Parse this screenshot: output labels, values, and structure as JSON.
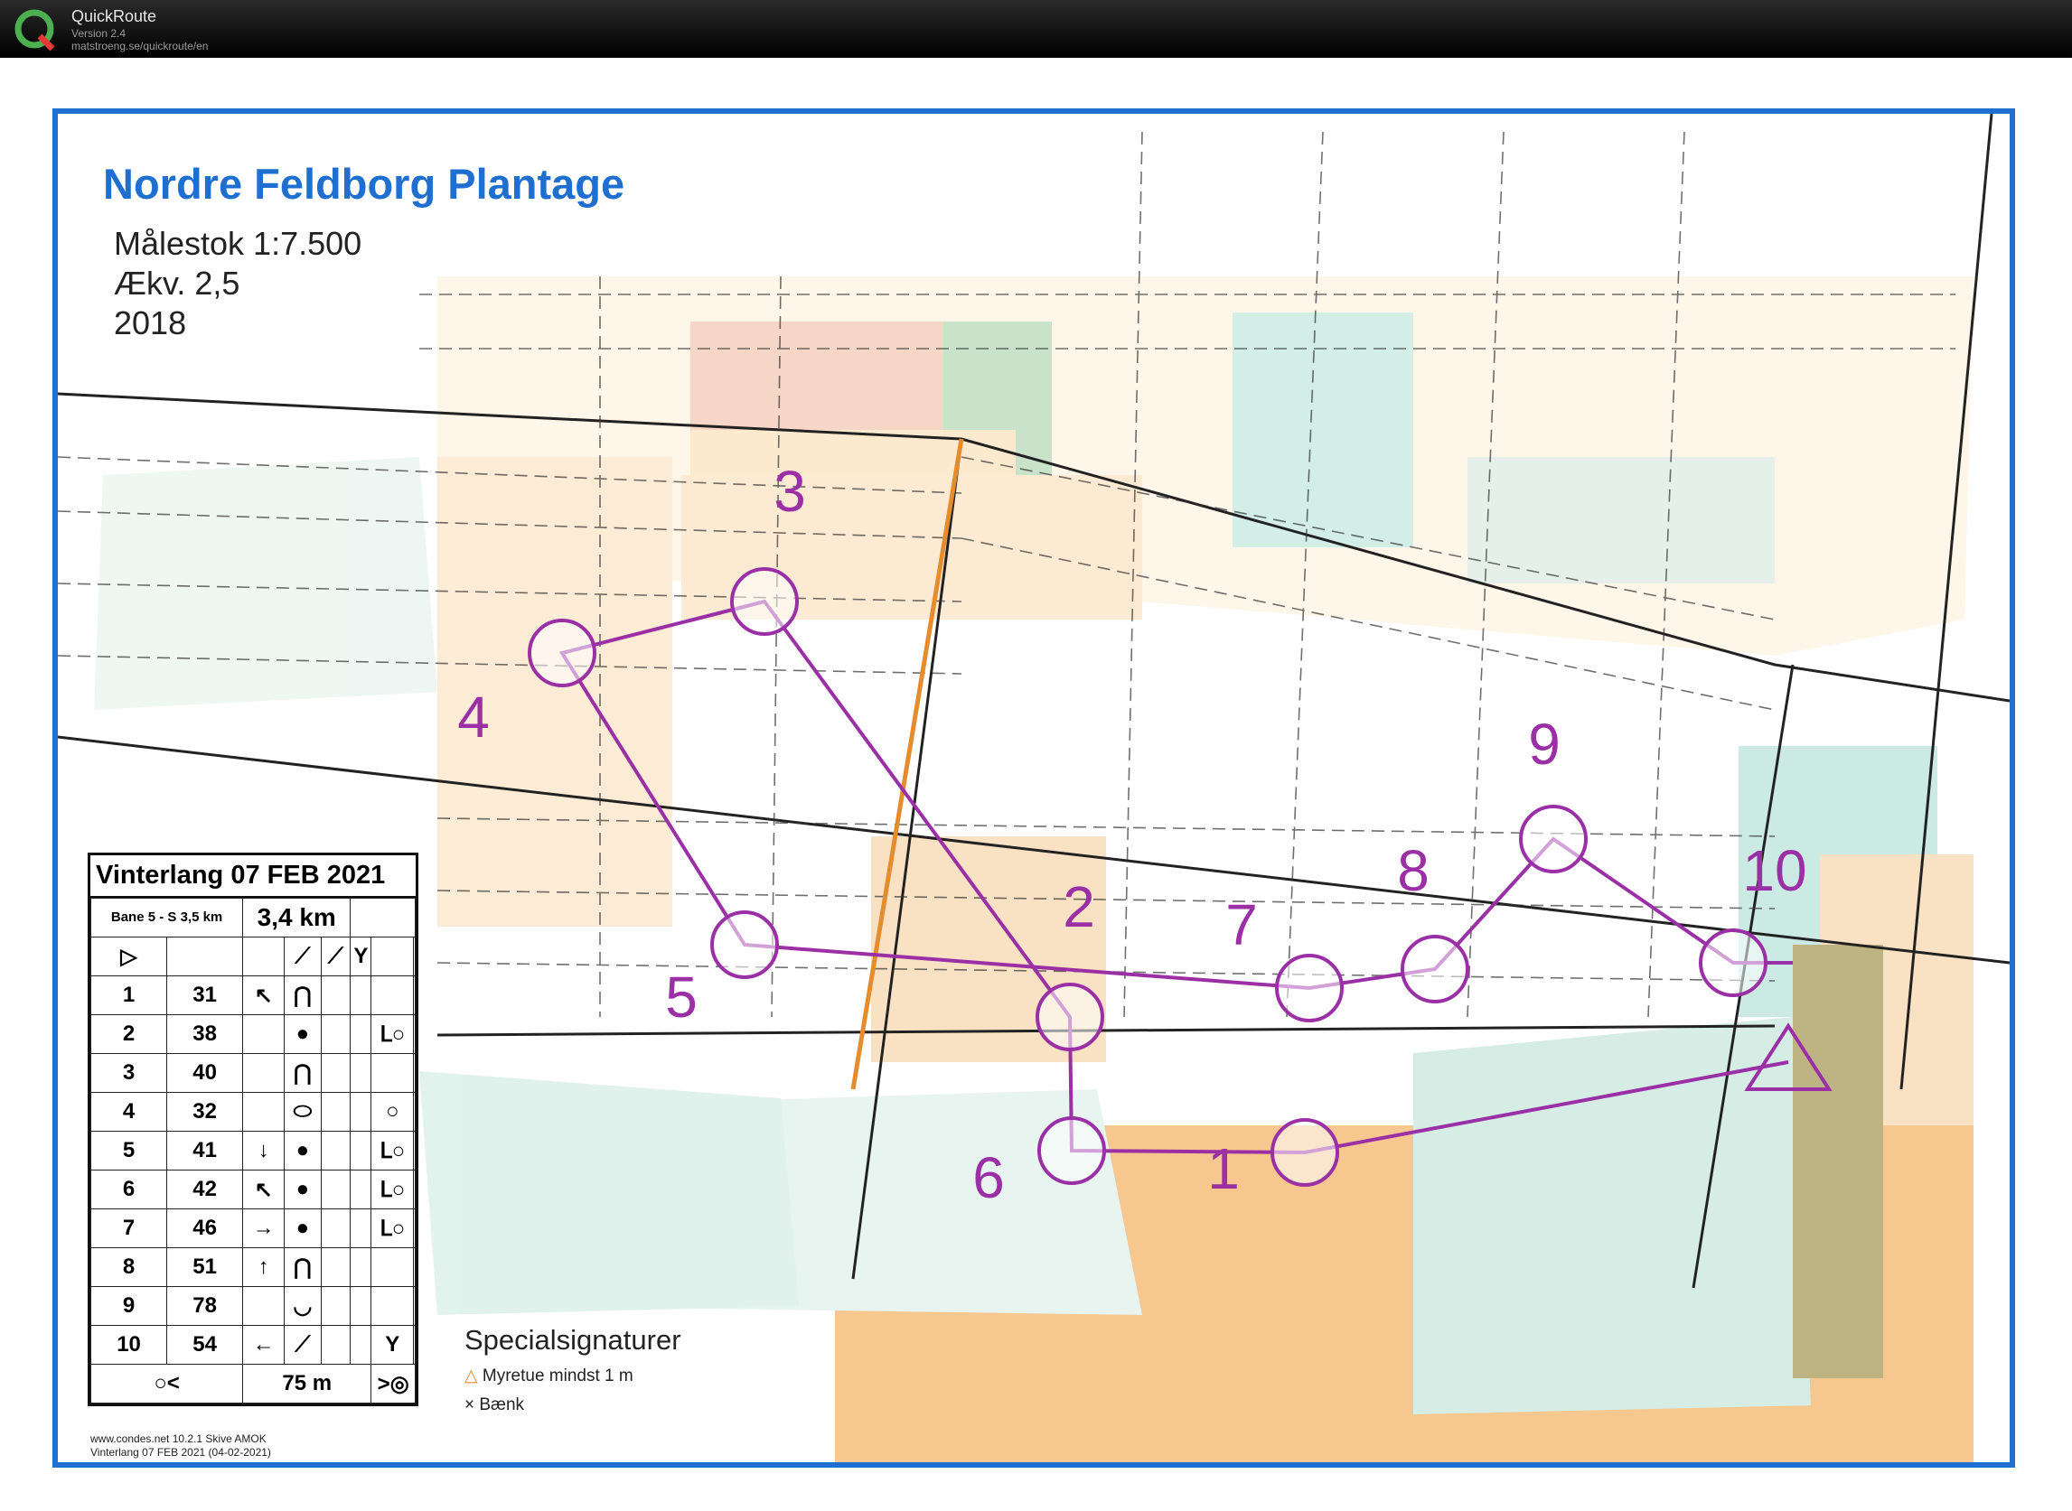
{
  "app": {
    "title": "QuickRoute",
    "version": "Version 2.4",
    "url": "matstroeng.se/quickroute/en"
  },
  "map": {
    "title": "Nordre Feldborg Plantage",
    "scale": "Målestok 1:7.500",
    "equidistance": "Ækv. 2,5",
    "year": "2018",
    "colors": {
      "course": "#9b2fa6",
      "frame": "#1f6fd0",
      "forest_open": "#f5d9a8",
      "green": "#b9e3da"
    }
  },
  "course": {
    "controls": [
      {
        "label": "1"
      },
      {
        "label": "2"
      },
      {
        "label": "3"
      },
      {
        "label": "4"
      },
      {
        "label": "5"
      },
      {
        "label": "6"
      },
      {
        "label": "7"
      },
      {
        "label": "8"
      },
      {
        "label": "9"
      },
      {
        "label": "10"
      }
    ]
  },
  "legend": {
    "title": "Vinterlang 07 FEB 2021",
    "course_name": "Bane 5 - S 3,5 km",
    "length": "3,4 km",
    "rows": [
      {
        "num": "1",
        "code": "31",
        "dir": "↖",
        "feat": "⋂",
        "extra": ""
      },
      {
        "num": "2",
        "code": "38",
        "dir": "",
        "feat": "●",
        "extra": "ᒪ○"
      },
      {
        "num": "3",
        "code": "40",
        "dir": "",
        "feat": "⋂",
        "extra": ""
      },
      {
        "num": "4",
        "code": "32",
        "dir": "",
        "feat": "⬭",
        "extra": "○"
      },
      {
        "num": "5",
        "code": "41",
        "dir": "↓",
        "feat": "●",
        "extra": "ᒪ○"
      },
      {
        "num": "6",
        "code": "42",
        "dir": "↖",
        "feat": "●",
        "extra": "ᒪ○"
      },
      {
        "num": "7",
        "code": "46",
        "dir": "→",
        "feat": "●",
        "extra": "ᒪ○"
      },
      {
        "num": "8",
        "code": "51",
        "dir": "↑",
        "feat": "⋂",
        "extra": ""
      },
      {
        "num": "9",
        "code": "78",
        "dir": "",
        "feat": "◡",
        "extra": ""
      },
      {
        "num": "10",
        "code": "54",
        "dir": "←",
        "feat": "⟋",
        "extra": "Y"
      }
    ],
    "finish_distance": "75 m"
  },
  "special": {
    "title": "Specialsignaturer",
    "items": [
      "Myretue mindst 1 m",
      "Bænk"
    ]
  },
  "footer": {
    "line1": "www.condes.net 10.2.1 Skive AMOK",
    "line2": "Vinterlang 07 FEB 2021 (04-02-2021)"
  }
}
